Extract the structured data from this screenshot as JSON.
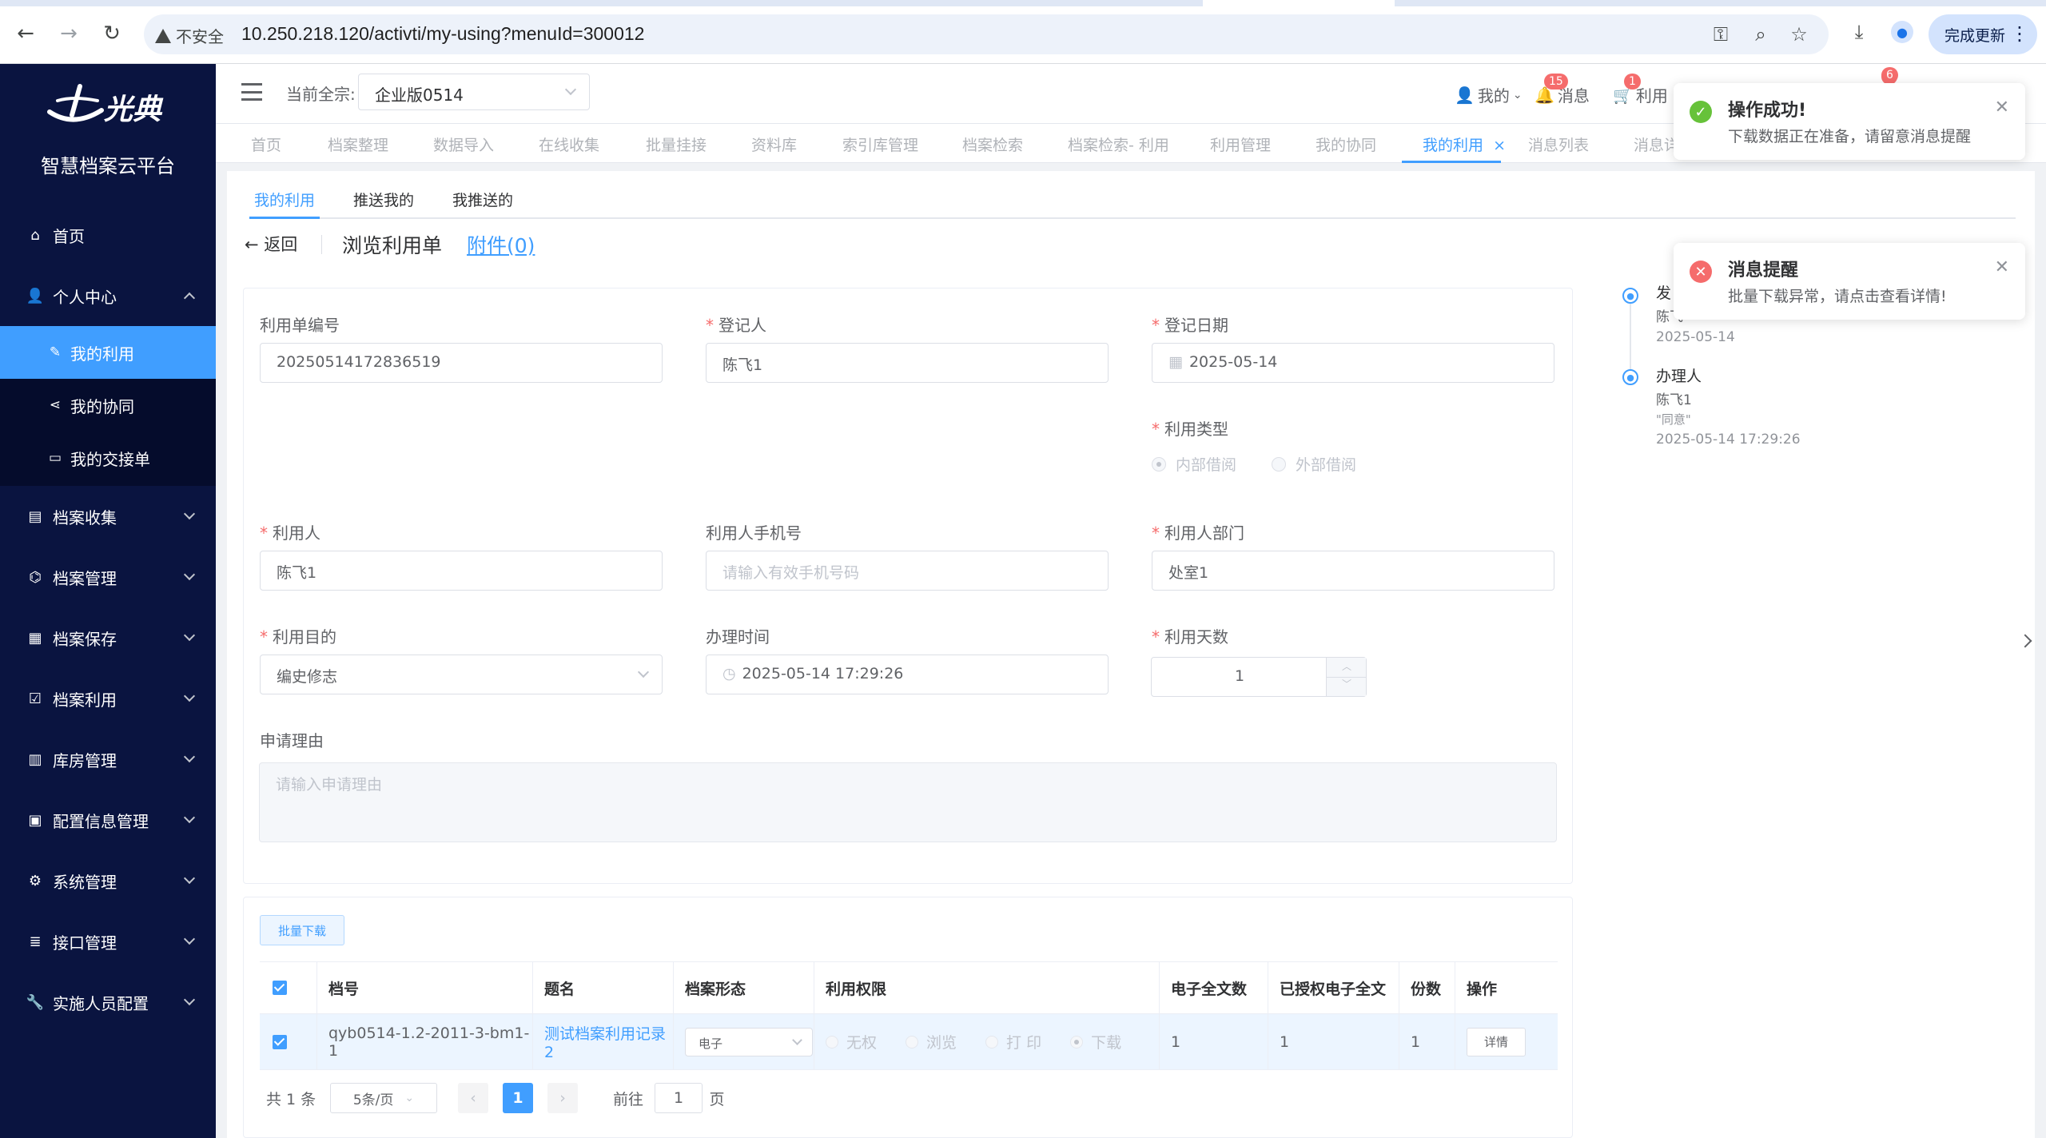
{
  "browser": {
    "insecure_label": "不安全",
    "url": "10.250.218.120/activti/my-using?menuId=300012",
    "update_label": "完成更新"
  },
  "sidebar": {
    "logo_text": "光典",
    "platform": "智慧档案云平台",
    "items": [
      {
        "label": "首页",
        "icon": "home-icon"
      },
      {
        "label": "个人中心",
        "icon": "user-icon"
      },
      {
        "label": "档案收集",
        "icon": "box-icon"
      },
      {
        "label": "档案管理",
        "icon": "bank-icon"
      },
      {
        "label": "档案保存",
        "icon": "building-icon"
      },
      {
        "label": "档案利用",
        "icon": "clipboard-icon"
      },
      {
        "label": "库房管理",
        "icon": "warehouse-icon"
      },
      {
        "label": "配置信息管理",
        "icon": "document-icon"
      },
      {
        "label": "系统管理",
        "icon": "gear-icon"
      },
      {
        "label": "接口管理",
        "icon": "database-icon"
      },
      {
        "label": "实施人员配置",
        "icon": "wrench-icon"
      }
    ],
    "sub_items": [
      {
        "label": "我的利用",
        "icon": "edit-icon"
      },
      {
        "label": "我的协同",
        "icon": "share-icon"
      },
      {
        "label": "我的交接单",
        "icon": "card-icon"
      }
    ]
  },
  "header": {
    "qz_label": "当前全宗:",
    "qz_value": "企业版0514",
    "my_label": "我的",
    "msg_label": "消息",
    "msg_badge": "15",
    "use_label": "利用",
    "use_badge": "1",
    "extra_badge": "6"
  },
  "tabs": [
    "首页",
    "档案整理",
    "数据导入",
    "在线收集",
    "批量挂接",
    "资料库",
    "索引库管理",
    "档案检索",
    "档案检索- 利用",
    "利用管理",
    "我的协同",
    "我的利用",
    "消息列表",
    "消息详"
  ],
  "active_tab_close": "×",
  "main": {
    "subtabs": [
      "我的利用",
      "推送我的",
      "我推送的"
    ],
    "back_label": "返回",
    "page_title": "浏览利用单",
    "attach_label": "附件(0)"
  },
  "form": {
    "bill_no_label": "利用单编号",
    "bill_no": "20250514172836519",
    "registrar_label": "登记人",
    "registrar": "陈飞1",
    "reg_date_label": "登记日期",
    "reg_date": "2025-05-14",
    "use_type_label": "利用类型",
    "use_type_options": [
      "内部借阅",
      "外部借阅"
    ],
    "user_label": "利用人",
    "user": "陈飞1",
    "phone_label": "利用人手机号",
    "phone_placeholder": "请输入有效手机号码",
    "dept_label": "利用人部门",
    "dept": "处室1",
    "purpose_label": "利用目的",
    "purpose": "编史修志",
    "handle_time_label": "办理时间",
    "handle_time": "2025-05-14 17:29:26",
    "days_label": "利用天数",
    "days": "1",
    "reason_label": "申请理由",
    "reason_placeholder": "请输入申请理由"
  },
  "table": {
    "batch_label": "批量下载",
    "headers": [
      "档号",
      "题名",
      "档案形态",
      "利用权限",
      "电子全文数",
      "已授权电子全文",
      "份数",
      "操作"
    ],
    "rows": [
      {
        "code": "qyb0514-1.2-2011-3-bm1-1",
        "title": "测试档案利用记录2",
        "form": "电子",
        "perms": [
          "无权",
          "浏览",
          "打 印",
          "下载"
        ],
        "e_count": "1",
        "auth_count": "1",
        "copies": "1",
        "action": "详情"
      }
    ],
    "pager": {
      "total": "共 1 条",
      "page_size": "5条/页",
      "current": "1",
      "goto_label": "前往",
      "goto_value": "1",
      "page_unit": "页"
    }
  },
  "timeline": [
    {
      "title": "发",
      "name": "陈飞",
      "date": "2025-05-14"
    },
    {
      "title": "办理人",
      "name": "陈飞1",
      "note": "\"同意\"",
      "date": "2025-05-14 17:29:26"
    }
  ],
  "toasts": [
    {
      "title": "操作成功!",
      "message": "下载数据正在准备，请留意消息提醒",
      "type": "success",
      "color": "#67c23a"
    },
    {
      "title": "消息提醒",
      "message": "批量下载异常，请点击查看详情!",
      "type": "error",
      "color": "#f56c6c"
    }
  ]
}
